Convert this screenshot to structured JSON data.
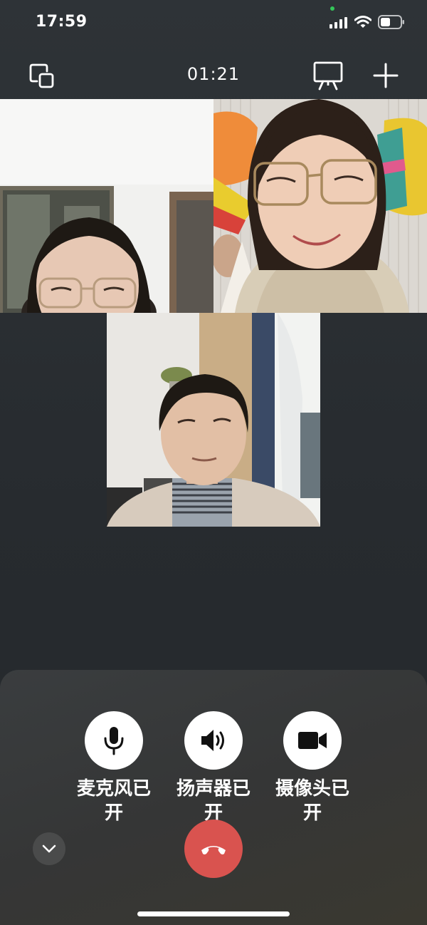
{
  "status_bar": {
    "time": "17:59"
  },
  "call": {
    "duration": "01:21"
  },
  "controls": {
    "microphone_label": "麦克风已开",
    "speaker_label": "扬声器已开",
    "camera_label": "摄像头已开"
  },
  "colors": {
    "background": "#2b3034",
    "panel": "#383838",
    "hangup": "#d9534f",
    "control_circle": "#ffffff"
  }
}
